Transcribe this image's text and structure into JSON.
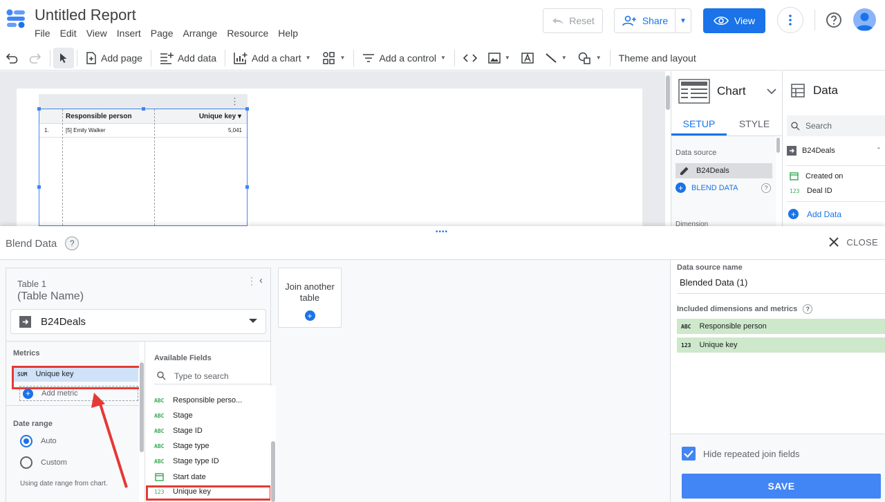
{
  "app": {
    "title": "Untitled Report",
    "menu": [
      "File",
      "Edit",
      "View",
      "Insert",
      "Page",
      "Arrange",
      "Resource",
      "Help"
    ],
    "reset_label": "Reset",
    "share_label": "Share",
    "view_label": "View"
  },
  "toolbar": {
    "add_page": "Add page",
    "add_data": "Add data",
    "add_chart": "Add a chart",
    "add_control": "Add a control",
    "theme_layout": "Theme and layout"
  },
  "canvas_table": {
    "col1": "Responsible person",
    "col2": "Unique key",
    "sort_indicator": "▾",
    "row_num": "1.",
    "row_person": "[5] Emily Walker",
    "row_value": "5,041"
  },
  "chart_panel": {
    "title": "Chart",
    "tab_setup": "SETUP",
    "tab_style": "STYLE",
    "data_source_label": "Data source",
    "data_source_value": "B24Deals",
    "blend_label": "BLEND DATA",
    "dimension_label": "Dimension"
  },
  "data_panel": {
    "title": "Data",
    "search_placeholder": "Search",
    "source": "B24Deals",
    "fields": [
      {
        "badge": "",
        "label": "Created on"
      },
      {
        "badge": "123",
        "label": "Deal ID"
      }
    ],
    "add_data": "Add Data"
  },
  "blend": {
    "title": "Blend Data",
    "help": "?",
    "close": "CLOSE",
    "table": {
      "label": "Table 1",
      "name": "(Table Name)",
      "source": "B24Deals",
      "metrics_label": "Metrics",
      "metric_badge": "SUM",
      "metric_name": "Unique key",
      "add_metric": "Add metric",
      "date_range_label": "Date range",
      "radio_auto": "Auto",
      "radio_custom": "Custom",
      "date_note": "Using date range from chart.",
      "available_label": "Available Fields",
      "search_placeholder": "Type to search",
      "fields": [
        {
          "badge": "ABC",
          "label": "Responsible perso..."
        },
        {
          "badge": "ABC",
          "label": "Stage"
        },
        {
          "badge": "ABC",
          "label": "Stage ID"
        },
        {
          "badge": "ABC",
          "label": "Stage type"
        },
        {
          "badge": "ABC",
          "label": "Stage type ID"
        },
        {
          "badge": "",
          "label": "Start date"
        },
        {
          "badge": "123",
          "label": "Unique key"
        }
      ]
    },
    "join_another": "Join another table",
    "settings": {
      "name_label": "Data source name",
      "name_value": "Blended Data (1)",
      "included_label": "Included dimensions and metrics",
      "included": [
        {
          "badge": "ABC",
          "label": "Responsible person"
        },
        {
          "badge": "123",
          "label": "Unique key"
        }
      ],
      "hide_repeated": "Hide repeated join fields",
      "save": "SAVE"
    }
  },
  "colors": {
    "accent": "#1a73e8",
    "highlight": "#e53935",
    "included_bg": "#cde8cb",
    "metric_bg": "#cfe2f8"
  }
}
